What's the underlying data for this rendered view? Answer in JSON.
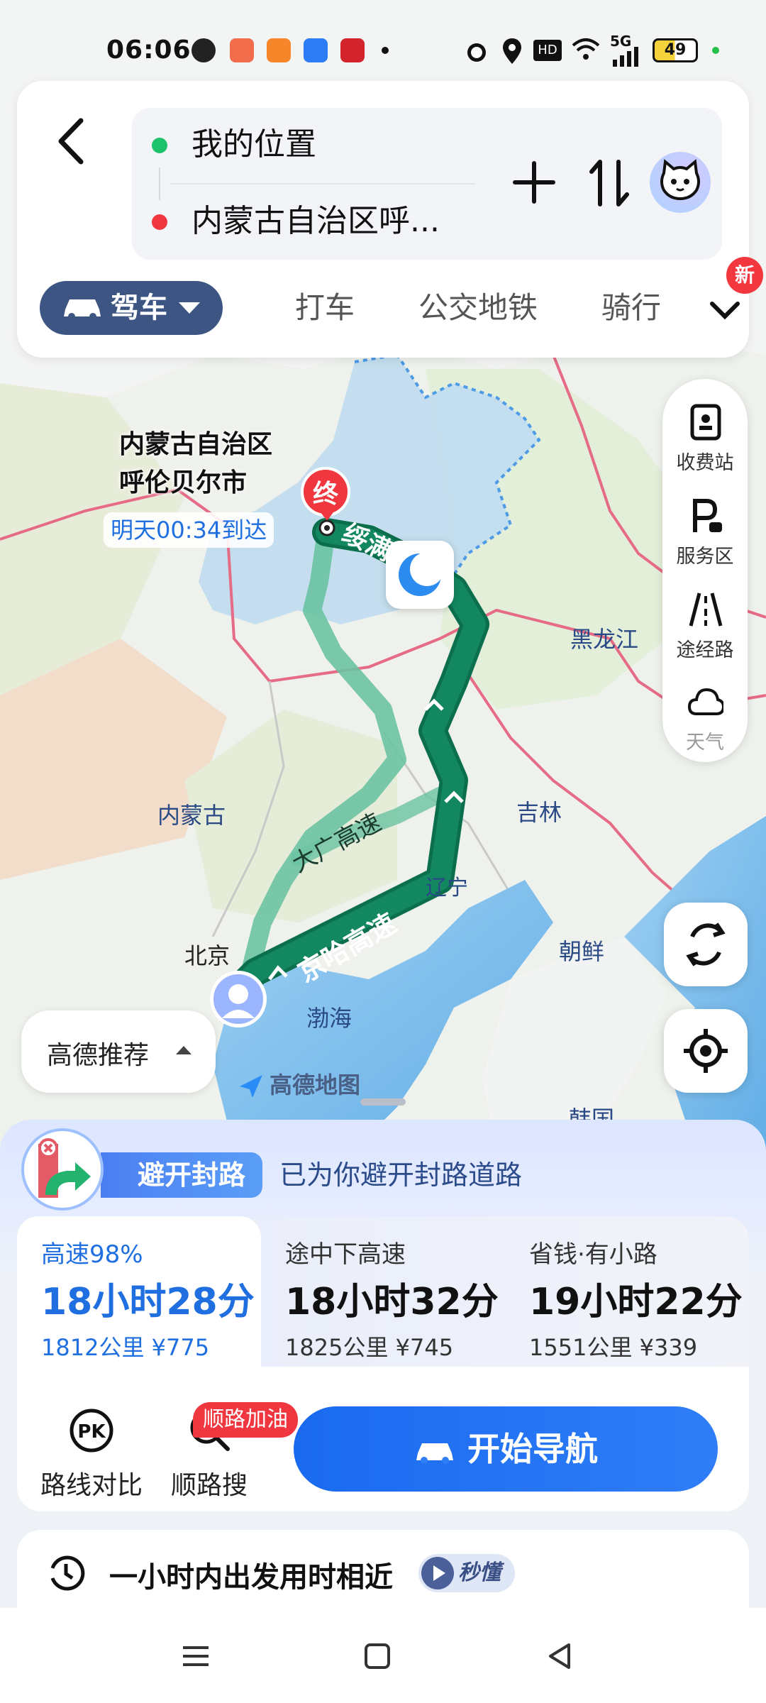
{
  "status_bar": {
    "time": "06:06",
    "network": "5G",
    "battery": "49"
  },
  "search": {
    "origin": "我的位置",
    "destination": "内蒙古自治区呼..."
  },
  "modes": {
    "active": "驾车",
    "tabs": [
      "打车",
      "公交地铁",
      "骑行"
    ],
    "new_badge": "新"
  },
  "map": {
    "destination_name_line1": "内蒙古自治区",
    "destination_name_line2": "呼伦贝尔市",
    "eta": "明天00:34到达",
    "end_marker": "终",
    "labels": {
      "heilongjiang": "黑龙江",
      "neimenggu": "内蒙古",
      "jilin": "吉林",
      "liaoning": "辽宁",
      "beijing": "北京",
      "chaoxian": "朝鲜",
      "bohai": "渤海",
      "hanguo": "韩国",
      "road_daguang": "大广高速",
      "road_jingha": "京哈高速",
      "road_suiman": "绥满"
    },
    "recommend": "高德推荐",
    "logo": "高德地图"
  },
  "side_tools": [
    "收费站",
    "服务区",
    "途经路",
    "天气"
  ],
  "notice": {
    "pill": "避开封路",
    "message": "已为你避开封路道路"
  },
  "routes": [
    {
      "tag": "高速98%",
      "duration": "18小时28分",
      "distance": "1812公里",
      "toll": "¥775",
      "active": true
    },
    {
      "tag": "途中下高速",
      "duration": "18小时32分",
      "distance": "1825公里",
      "toll": "¥745",
      "active": false
    },
    {
      "tag": "省钱·有小路",
      "duration": "19小时22分",
      "distance": "1551公里",
      "toll": "¥339",
      "active": false
    }
  ],
  "actions": {
    "compare": "路线对比",
    "along_search": "顺路搜",
    "fuel_badge": "顺路加油",
    "start_nav": "开始导航"
  },
  "tip": {
    "text": "一小时内出发用时相近",
    "badge": "秒懂"
  },
  "colors": {
    "route_main": "#13875f",
    "route_alt": "#6cc3a3",
    "accent_blue": "#1f6fe0",
    "mode_active": "#3c5583"
  }
}
